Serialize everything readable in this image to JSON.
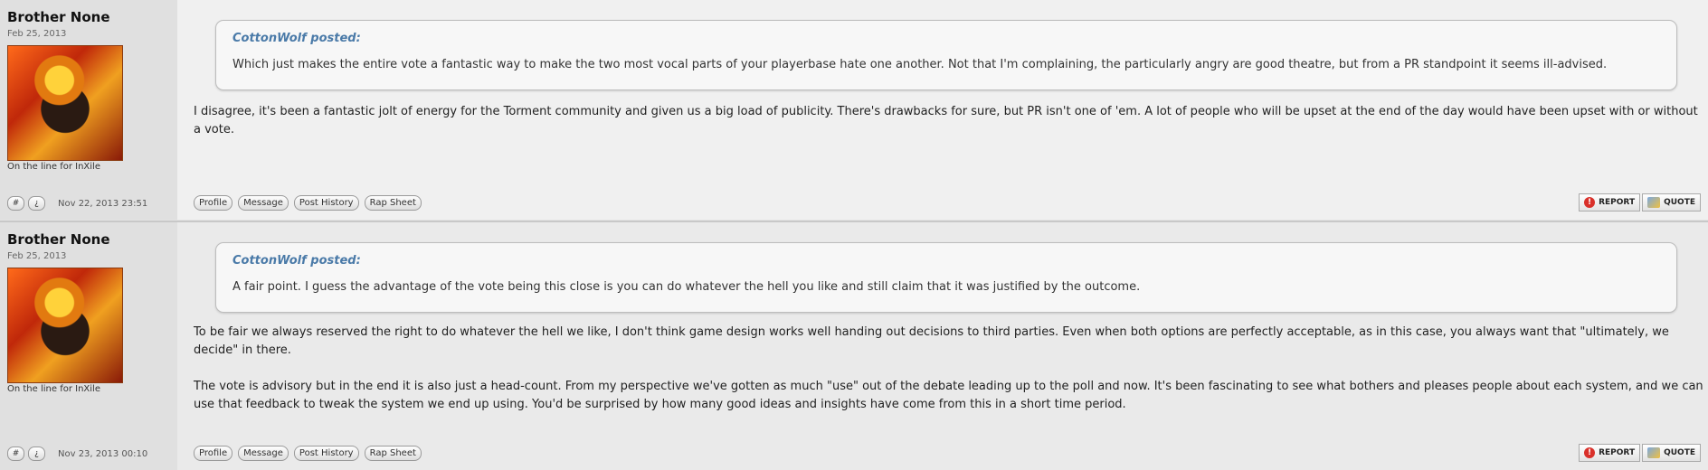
{
  "posts": [
    {
      "username": "Brother None",
      "join_date": "Feb 25, 2013",
      "user_title": "On the line for InXile",
      "post_time": "Nov 22, 2013 23:51",
      "quote_author": "CottonWolf posted:",
      "quote_text": "Which just makes the entire vote a fantastic way to make the two most vocal parts of your playerbase hate one another. Not that I'm complaining, the particularly angry are good theatre, but from a PR standpoint it seems ill-advised.",
      "message": [
        "I disagree, it's been a fantastic jolt of energy for the Torment community and given us a big load of publicity. There's drawbacks for sure, but PR isn't one of 'em. A lot of people who will be upset at the end of the day would have been upset with or without a vote."
      ]
    },
    {
      "username": "Brother None",
      "join_date": "Feb 25, 2013",
      "user_title": "On the line for InXile",
      "post_time": "Nov 23, 2013 00:10",
      "quote_author": "CottonWolf posted:",
      "quote_text": "A fair point. I guess the advantage of the vote being this close is you can do whatever the hell you like and still claim that it was justified by the outcome.",
      "message": [
        "To be fair we always reserved the right to do whatever the hell we like, I don't think game design works well handing out decisions to third parties. Even when both options are perfectly acceptable, as in this case, you always want that \"ultimately, we decide\" in there.",
        "The vote is advisory but in the end it is also just a head-count. From my perspective we've gotten as much \"use\" out of the debate leading up to the poll and now. It's been fascinating to see what bothers and pleases people about each system, and we can use that feedback to tweak the system we end up using. You'd be surprised by how many good ideas and insights have come from this in a short time period."
      ]
    }
  ],
  "buttons": {
    "hash": "#",
    "question": "¿",
    "profile": "Profile",
    "message": "Message",
    "post_history": "Post History",
    "rap_sheet": "Rap Sheet",
    "report": "REPORT",
    "quote": "QUOTE"
  }
}
